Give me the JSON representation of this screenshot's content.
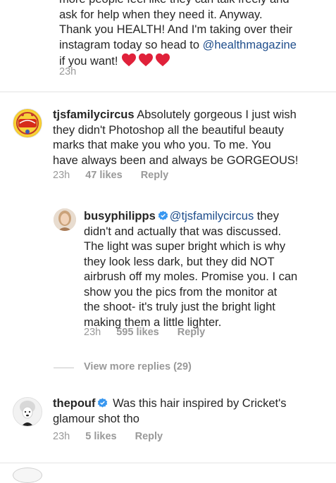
{
  "colors": {
    "text": "#262626",
    "meta": "#999999",
    "link": "#1f4e8c",
    "heart": "#e0213a",
    "verified": "#3897f0"
  },
  "first_comment": {
    "line0": "more people feel like they can talk freely and",
    "line1": "ask for help when they need it. Anyway.",
    "line2": "Thank you HEALTH! And I'm taking over their",
    "line3_before": "instagram today so head to ",
    "line3_mention": "@healthmagazine",
    "line4": "if you want!",
    "hearts": [
      "red-heart-icon",
      "red-heart-icon",
      "red-heart-icon"
    ],
    "time": "23h"
  },
  "comment1": {
    "username": "tjsfamilycircus",
    "avatar_text": "FAMILY CIRCUS",
    "line1_rest": "Absolutely gorgeous I just wish",
    "line2": "they didn't Photoshop all the beautiful beauty",
    "line3": "marks that make you who you. To me. You",
    "line4": "have always been and always be GORGEOUS!",
    "time": "23h",
    "likes": "47 likes",
    "reply": "Reply"
  },
  "reply1": {
    "username": "busyphilipps",
    "mention": "@tjsfamilycircus",
    "line1_rest": "they",
    "line2": "didn't and actually that was discussed.",
    "line3": "The light was super bright which is why",
    "line4": "they look less dark, but they did NOT",
    "line5": "airbrush off my moles. Promise you. I can",
    "line6": "show you the pics from the monitor at",
    "line7": "the shoot- it's truly just the bright light",
    "line8": "making them a little lighter.",
    "time": "23h",
    "likes": "595 likes",
    "reply": "Reply"
  },
  "view_more": "View more replies (29)",
  "comment2": {
    "username": "thepouf",
    "line1_rest": "Was this hair inspired by Cricket's",
    "line2": "glamour shot tho",
    "time": "23h",
    "likes": "5 likes",
    "reply": "Reply"
  }
}
